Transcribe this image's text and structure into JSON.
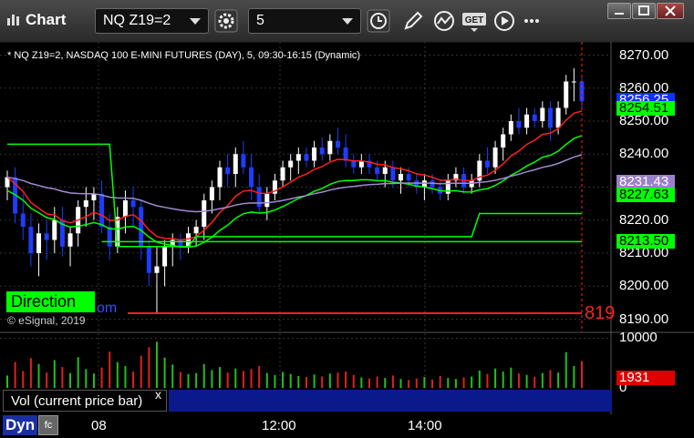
{
  "window": {
    "title": "Chart"
  },
  "toolbar": {
    "symbol": "NQ Z19=2",
    "interval": "5"
  },
  "chart_info": "* NQ Z19=2, NASDAQ 100 E-MINI FUTURES (DAY), 5, 09:30-16:15 (Dynamic)",
  "copyright": "© eSignal, 2019",
  "direction_label": "Direction",
  "direction_tail": "om",
  "red_edge_label": "819",
  "vol_label": "Vol (current price bar)",
  "vol_close": "x",
  "dyn_label": "Dyn",
  "dyn_icon": "fc",
  "price_labels": [
    "8270.00",
    "8260.00",
    "8250.00",
    "8240.00",
    "8230.00",
    "8220.00",
    "8210.00",
    "8200.00",
    "8190.00"
  ],
  "volume_labels": [
    "10000",
    "0"
  ],
  "x_labels": [
    "08",
    "12:00",
    "14:00"
  ],
  "tags": [
    {
      "text": "8256.25",
      "bg": "#1030ff",
      "fg": "#ffffff",
      "price": 8256.25
    },
    {
      "text": "8254.51",
      "bg": "#00ff00",
      "fg": "#000000",
      "price": 8254.0
    },
    {
      "text": "8231.43",
      "bg": "#9b80cc",
      "fg": "#ffffff",
      "price": 8231.43
    },
    {
      "text": "8227.63",
      "bg": "#00ff00",
      "fg": "#000000",
      "price": 8227.63
    },
    {
      "text": "8213.50",
      "bg": "#00ff00",
      "fg": "#000000",
      "price": 8213.5
    },
    {
      "text": "1931",
      "bg": "#e00000",
      "fg": "#ffffff",
      "volume": 1931
    }
  ],
  "colors": {
    "bull": "#ffffff",
    "bear": "#1e3cff",
    "red": "#ff2020",
    "green": "#00ff00",
    "purple": "#a08ad0"
  },
  "chart_data": {
    "type": "candlestick",
    "title": "* NQ Z19=2, NASDAQ 100 E-MINI FUTURES (DAY), 5, 09:30-16:15 (Dynamic)",
    "ylim": [
      8186,
      8274
    ],
    "volume_ylim": [
      0,
      11000
    ],
    "candles": [
      [
        8230,
        8235,
        8226,
        8233,
        2500
      ],
      [
        8233,
        8236,
        8219,
        8222,
        5200
      ],
      [
        8222,
        8228,
        8214,
        8218,
        3400
      ],
      [
        8218,
        8222,
        8206,
        8210,
        6000
      ],
      [
        8210,
        8219,
        8203,
        8216,
        4800
      ],
      [
        8216,
        8220,
        8208,
        8214,
        3100
      ],
      [
        8214,
        8224,
        8210,
        8220,
        5600
      ],
      [
        8220,
        8224,
        8209,
        8212,
        4200
      ],
      [
        8212,
        8218,
        8206,
        8216,
        3000
      ],
      [
        8216,
        8226,
        8212,
        8224,
        6200
      ],
      [
        8224,
        8230,
        8218,
        8226,
        3800
      ],
      [
        8226,
        8230,
        8220,
        8228,
        2900
      ],
      [
        8228,
        8232,
        8216,
        8218,
        4100
      ],
      [
        8218,
        8222,
        8208,
        8212,
        7300
      ],
      [
        8212,
        8224,
        8210,
        8221,
        5200
      ],
      [
        8221,
        8229,
        8216,
        8226,
        4400
      ],
      [
        8226,
        8230,
        8218,
        8224,
        3300
      ],
      [
        8224,
        8226,
        8208,
        8212,
        6500
      ],
      [
        8212,
        8214,
        8200,
        8204,
        8200
      ],
      [
        8204,
        8212,
        8192,
        8206,
        9300
      ],
      [
        8206,
        8214,
        8200,
        8212,
        6100
      ],
      [
        8212,
        8216,
        8206,
        8214,
        4700
      ],
      [
        8214,
        8216,
        8208,
        8212,
        3200
      ],
      [
        8212,
        8218,
        8210,
        8216,
        2800
      ],
      [
        8216,
        8220,
        8212,
        8218,
        3000
      ],
      [
        8218,
        8228,
        8214,
        8226,
        4800
      ],
      [
        8226,
        8232,
        8222,
        8230,
        3600
      ],
      [
        8230,
        8238,
        8226,
        8236,
        4200
      ],
      [
        8236,
        8240,
        8230,
        8234,
        3100
      ],
      [
        8234,
        8242,
        8230,
        8240,
        3900
      ],
      [
        8240,
        8244,
        8234,
        8236,
        3400
      ],
      [
        8236,
        8240,
        8226,
        8230,
        3800
      ],
      [
        8230,
        8234,
        8222,
        8224,
        4400
      ],
      [
        8224,
        8230,
        8220,
        8228,
        3000
      ],
      [
        8228,
        8234,
        8226,
        8232,
        2600
      ],
      [
        8232,
        8238,
        8230,
        8236,
        3200
      ],
      [
        8236,
        8240,
        8232,
        8238,
        2800
      ],
      [
        8238,
        8242,
        8234,
        8240,
        2400
      ],
      [
        8240,
        8242,
        8236,
        8238,
        2200
      ],
      [
        8238,
        8244,
        8236,
        8242,
        2700
      ],
      [
        8242,
        8245,
        8238,
        8240,
        2300
      ],
      [
        8240,
        8246,
        8238,
        8244,
        2900
      ],
      [
        8244,
        8248,
        8240,
        8242,
        3100
      ],
      [
        8242,
        8246,
        8236,
        8238,
        3300
      ],
      [
        8238,
        8240,
        8234,
        8236,
        2600
      ],
      [
        8236,
        8240,
        8234,
        8238,
        2100
      ],
      [
        8238,
        8240,
        8234,
        8236,
        1900
      ],
      [
        8236,
        8238,
        8232,
        8234,
        2300
      ],
      [
        8234,
        8238,
        8230,
        8236,
        2000
      ],
      [
        8236,
        8238,
        8230,
        8232,
        2500
      ],
      [
        8232,
        8236,
        8228,
        8234,
        1800
      ],
      [
        8234,
        8236,
        8230,
        8232,
        1600
      ],
      [
        8232,
        8234,
        8228,
        8230,
        1900
      ],
      [
        8230,
        8234,
        8226,
        8232,
        2200
      ],
      [
        8232,
        8234,
        8228,
        8230,
        1700
      ],
      [
        8230,
        8232,
        8226,
        8228,
        2400
      ],
      [
        8228,
        8234,
        8226,
        8232,
        2000
      ],
      [
        8232,
        8236,
        8230,
        8234,
        1800
      ],
      [
        8234,
        8236,
        8228,
        8230,
        2100
      ],
      [
        8230,
        8234,
        8228,
        8232,
        2300
      ],
      [
        8232,
        8240,
        8230,
        8238,
        3500
      ],
      [
        8238,
        8242,
        8234,
        8236,
        2800
      ],
      [
        8236,
        8244,
        8234,
        8242,
        3900
      ],
      [
        8242,
        8248,
        8238,
        8246,
        3300
      ],
      [
        8246,
        8252,
        8244,
        8250,
        4100
      ],
      [
        8250,
        8254,
        8246,
        8248,
        2900
      ],
      [
        8248,
        8254,
        8246,
        8252,
        2600
      ],
      [
        8252,
        8254,
        8248,
        8250,
        2200
      ],
      [
        8250,
        8256,
        8248,
        8254,
        3000
      ],
      [
        8254,
        8256,
        8244,
        8248,
        3600
      ],
      [
        8248,
        8256,
        8246,
        8254,
        3100
      ],
      [
        8254,
        8264,
        8252,
        8262,
        7200
      ],
      [
        8262,
        8266,
        8256,
        8262,
        4400
      ],
      [
        8262,
        8264,
        8254,
        8256,
        5400
      ]
    ]
  }
}
